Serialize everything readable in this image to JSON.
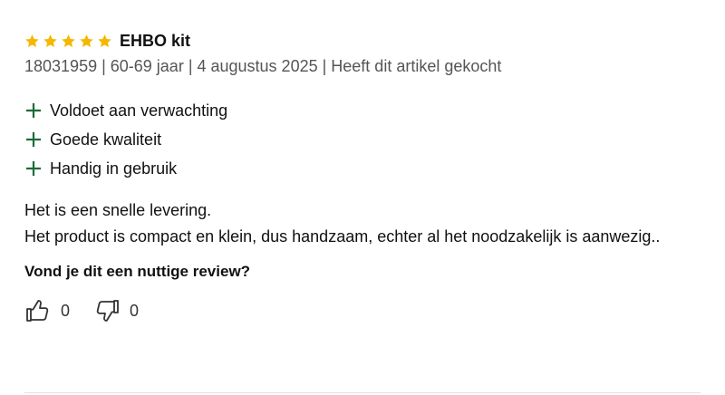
{
  "review": {
    "rating": 5,
    "title": "EHBO kit",
    "meta": "18031959 | 60-69 jaar | 4 augustus 2025 | Heeft dit artikel gekocht",
    "pros": [
      "Voldoet aan verwachting",
      "Goede kwaliteit",
      "Handig in gebruik"
    ],
    "body_lines": [
      "Het is een snelle levering.",
      "Het product is compact en klein, dus handzaam, echter al het noodzakelijk is aanwezig.."
    ]
  },
  "helpful": {
    "question": "Vond je dit een nuttige review?",
    "up_count": "0",
    "down_count": "0"
  },
  "colors": {
    "star": "#F5B700",
    "plus": "#1E6B3A",
    "icon": "#333333"
  }
}
